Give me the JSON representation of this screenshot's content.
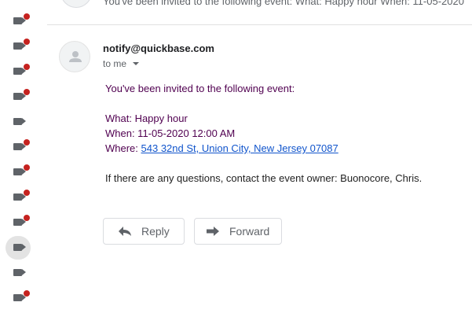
{
  "rail": {
    "items": [
      {
        "icon": "label-icon",
        "unread": true,
        "selected": false
      },
      {
        "icon": "label-icon",
        "unread": true,
        "selected": false
      },
      {
        "icon": "label-icon",
        "unread": true,
        "selected": false
      },
      {
        "icon": "label-icon",
        "unread": true,
        "selected": false
      },
      {
        "icon": "label-icon",
        "unread": false,
        "selected": false
      },
      {
        "icon": "label-icon",
        "unread": true,
        "selected": false
      },
      {
        "icon": "label-icon",
        "unread": true,
        "selected": false
      },
      {
        "icon": "label-icon",
        "unread": true,
        "selected": false
      },
      {
        "icon": "label-icon",
        "unread": true,
        "selected": false
      },
      {
        "icon": "label-icon",
        "unread": false,
        "selected": true
      },
      {
        "icon": "label-icon",
        "unread": false,
        "selected": false
      },
      {
        "icon": "label-icon",
        "unread": true,
        "selected": false
      }
    ],
    "colors": {
      "label": "#5f6368",
      "unread_dot": "#c5221f",
      "selected_bg": "#e3e3e3"
    }
  },
  "previous_message": {
    "snippet": "You've been invited to the following event: What: Happy hour When: 11-05-2020"
  },
  "message": {
    "sender": "notify@quickbase.com",
    "recipient": "to me",
    "intro": "You've been invited to the following event:",
    "what": "What: Happy hour",
    "when": "When: 11-05-2020 12:00 AM",
    "where_label": "Where: ",
    "where_link": "543 32nd St, Union City, New Jersey 07087",
    "footer": "If there are any questions, contact the event owner: Buonocore, Chris."
  },
  "actions": {
    "reply_label": "Reply",
    "forward_label": "Forward"
  }
}
